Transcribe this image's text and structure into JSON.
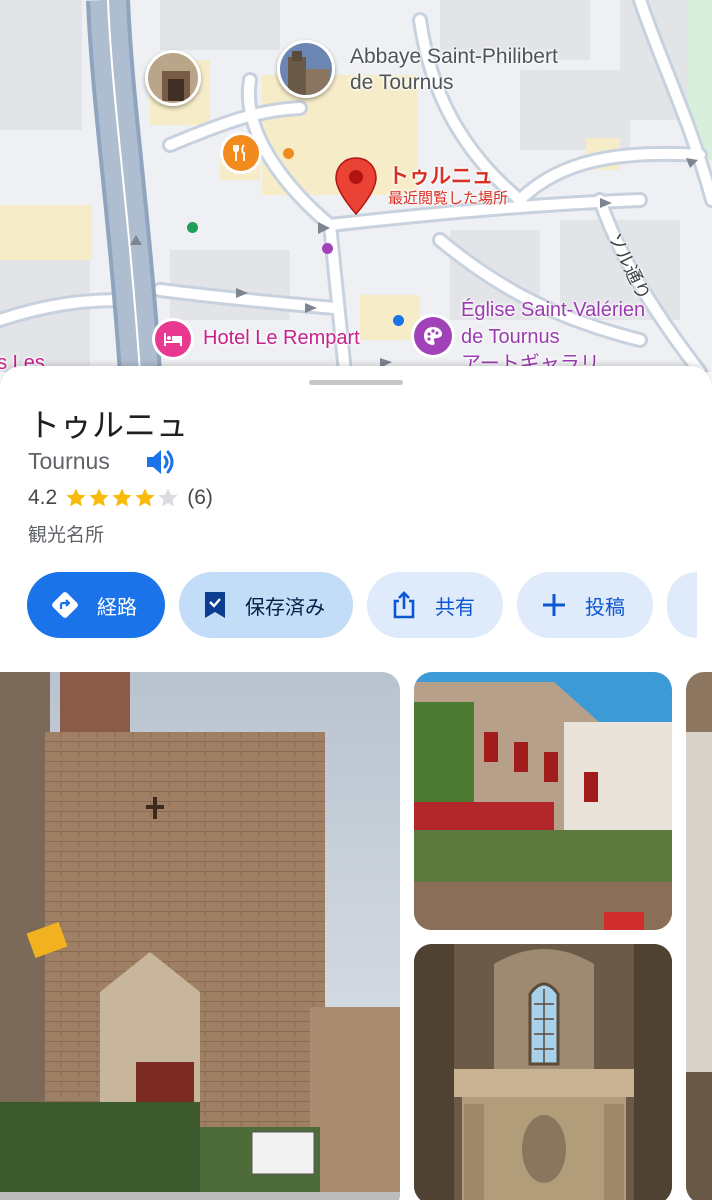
{
  "map": {
    "poi_abbaye_line1": "Abbaye Saint-Philibert",
    "poi_abbaye_line2": "de Tournus",
    "pin_title": "トゥルニュ",
    "pin_subtitle": "最近閲覧した場所",
    "street_label": "ソル通り",
    "hotel_label": "Hotel Le Rempart",
    "eglise_line1": "Église Saint-Valérien",
    "eglise_line2": "de Tournus",
    "eglise_line3_partial": "アートギャラリ",
    "left_partial_label": "es Les",
    "icons": [
      "restaurant-icon",
      "hotel-icon",
      "art-gallery-icon",
      "place-pin-icon"
    ],
    "colors": {
      "pin": "#d93025",
      "restaurant": "#f28b1e",
      "hotel": "#e8388f",
      "gallery": "#a142b8"
    }
  },
  "place": {
    "name": "トゥルニュ",
    "latin_name": "Tournus",
    "rating": "4.2",
    "rating_stars": 4.2,
    "reviews": "(6)",
    "category": "観光名所"
  },
  "actions": {
    "directions": "経路",
    "saved": "保存済み",
    "share": "共有",
    "post": "投稿"
  },
  "photos": [
    "church-facade-photo",
    "street-cafe-photo",
    "chapel-altar-photo"
  ],
  "colors": {
    "accent": "#1a73e8",
    "chip_bg": "#dfeafa",
    "star": "#f9bb0a"
  }
}
